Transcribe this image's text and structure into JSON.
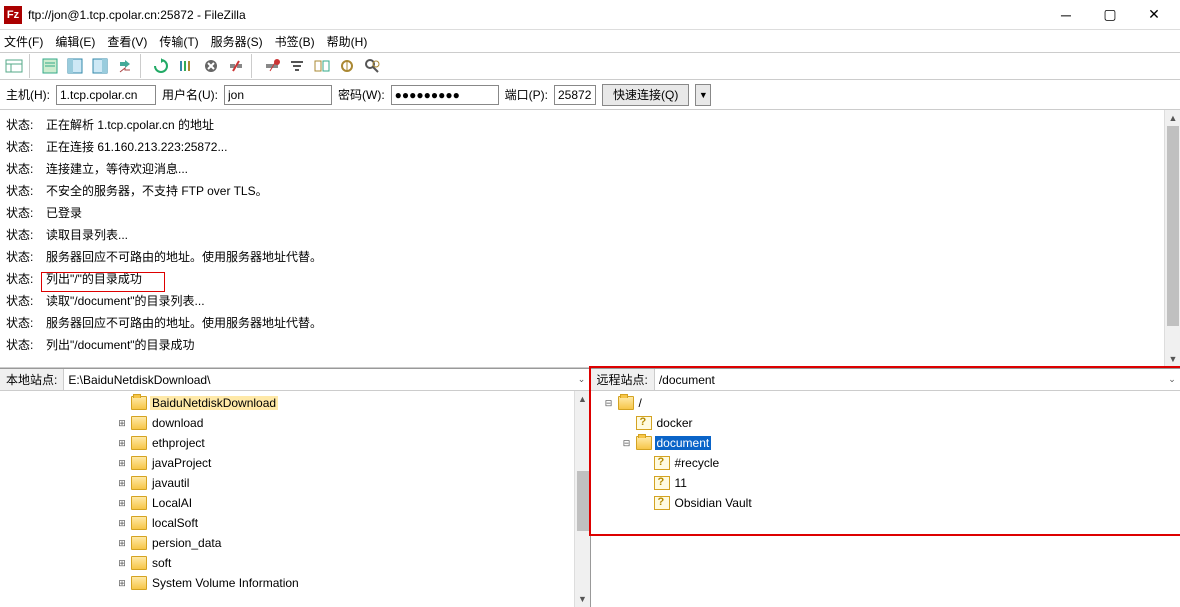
{
  "window": {
    "title": "ftp://jon@1.tcp.cpolar.cn:25872 - FileZilla"
  },
  "menu": {
    "file": "文件(F)",
    "edit": "编辑(E)",
    "view": "查看(V)",
    "transfer": "传输(T)",
    "server": "服务器(S)",
    "bookmarks": "书签(B)",
    "help": "帮助(H)"
  },
  "quick": {
    "host_lbl": "主机(H):",
    "host": "1.tcp.cpolar.cn",
    "user_lbl": "用户名(U):",
    "user": "jon",
    "pass_lbl": "密码(W):",
    "pass": "●●●●●●●●●",
    "port_lbl": "端口(P):",
    "port": "25872",
    "connect": "快速连接(Q)"
  },
  "log": {
    "label": "状态:",
    "lines": [
      "正在解析 1.tcp.cpolar.cn 的地址",
      "正在连接 61.160.213.223:25872...",
      "连接建立，等待欢迎消息...",
      "不安全的服务器，不支持 FTP over TLS。",
      "已登录",
      "读取目录列表...",
      "服务器回应不可路由的地址。使用服务器地址代替。",
      "列出\"/\"的目录成功",
      "读取\"/document\"的目录列表...",
      "服务器回应不可路由的地址。使用服务器地址代替。",
      "列出\"/document\"的目录成功"
    ]
  },
  "local": {
    "label": "本地站点:",
    "path": "E:\\BaiduNetdiskDownload\\",
    "items": [
      {
        "name": "BaiduNetdiskDownload",
        "depth": 3,
        "exp": "",
        "sel": true,
        "open": true
      },
      {
        "name": "download",
        "depth": 3,
        "exp": "⊞"
      },
      {
        "name": "ethproject",
        "depth": 3,
        "exp": "⊞"
      },
      {
        "name": "javaProject",
        "depth": 3,
        "exp": "⊞"
      },
      {
        "name": "javautil",
        "depth": 3,
        "exp": "⊞"
      },
      {
        "name": "LocalAI",
        "depth": 3,
        "exp": "⊞"
      },
      {
        "name": "localSoft",
        "depth": 3,
        "exp": "⊞"
      },
      {
        "name": "persion_data",
        "depth": 3,
        "exp": "⊞"
      },
      {
        "name": "soft",
        "depth": 3,
        "exp": "⊞"
      },
      {
        "name": "System Volume Information",
        "depth": 3,
        "exp": "⊞"
      }
    ]
  },
  "remote": {
    "label": "远程站点:",
    "path": "/document",
    "items": [
      {
        "name": "/",
        "depth": 0,
        "exp": "⊟",
        "icon": "folder",
        "open": true
      },
      {
        "name": "docker",
        "depth": 1,
        "exp": "",
        "icon": "q"
      },
      {
        "name": "document",
        "depth": 1,
        "exp": "⊟",
        "icon": "folder",
        "rsel": true,
        "open": true
      },
      {
        "name": "#recycle",
        "depth": 2,
        "exp": "",
        "icon": "q"
      },
      {
        "name": "11",
        "depth": 2,
        "exp": "",
        "icon": "q"
      },
      {
        "name": "Obsidian Vault",
        "depth": 2,
        "exp": "",
        "icon": "q"
      }
    ]
  }
}
